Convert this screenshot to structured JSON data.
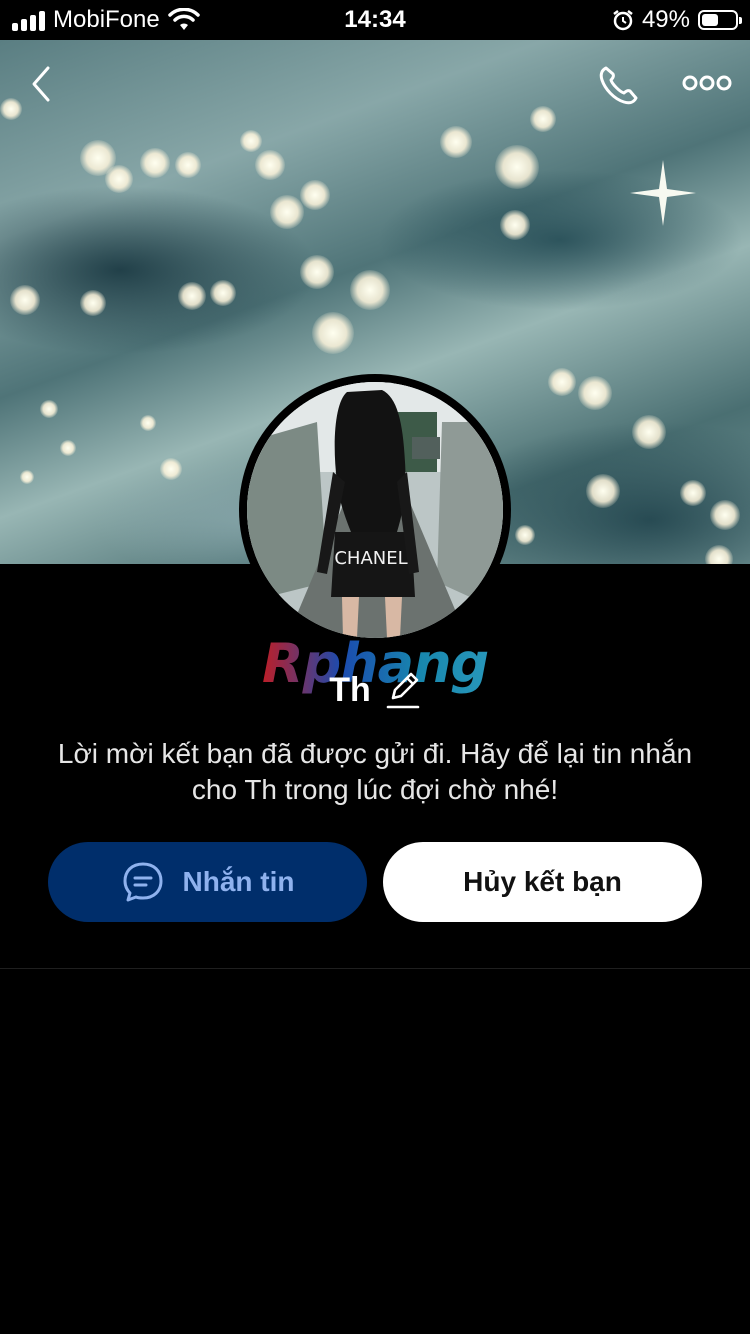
{
  "status_bar": {
    "carrier": "MobiFone",
    "time": "14:34",
    "battery_percent": "49%",
    "battery_level": 0.49
  },
  "profile": {
    "watermark": "Rphang",
    "name": "Th",
    "avatar_shirt_text": "CHANEL"
  },
  "message": "Lời mời kết bạn đã được gửi đi. Hãy để lại tin nhắn cho Th trong lúc đợi chờ nhé!",
  "actions": {
    "message_label": "Nhắn tin",
    "cancel_label": "Hủy kết bạn"
  },
  "colors": {
    "message_button_bg": "#002e6b",
    "message_button_text": "#8fb2ee",
    "cancel_button_bg": "#ffffff"
  },
  "icons": {
    "back": "chevron-left-icon",
    "call": "phone-icon",
    "more": "more-icon",
    "edit": "pencil-icon",
    "chat": "chat-bubble-icon"
  }
}
